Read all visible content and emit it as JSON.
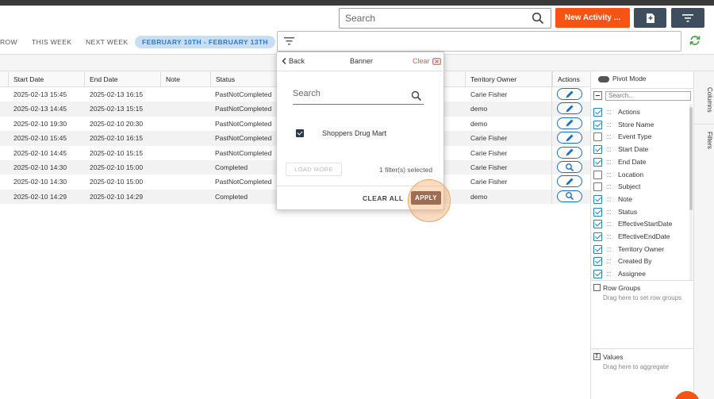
{
  "header": {
    "search_placeholder": "Search",
    "new_activity_label": "New Activity ...",
    "brand_color": "#f65314"
  },
  "periods": [
    {
      "label": "ROW",
      "active": false
    },
    {
      "label": "THIS WEEK",
      "active": false
    },
    {
      "label": "NEXT WEEK",
      "active": false
    },
    {
      "label": "FEBRUARY 10TH - FEBRUARY 13TH",
      "active": true
    }
  ],
  "grid": {
    "columns": [
      "Start Date",
      "End Date",
      "Note",
      "Status",
      "Territory Owner",
      "Actions"
    ],
    "rows": [
      {
        "start": "2025-02-13 15:45",
        "end": "2025-02-13 16:15",
        "status": "PastNotCompleted",
        "owner": "Carie Fisher",
        "action": "edit"
      },
      {
        "start": "2025-02-13 14:45",
        "end": "2025-02-13 15:15",
        "status": "PastNotCompleted",
        "owner": "demo",
        "action": "edit"
      },
      {
        "start": "2025-02-10 19:30",
        "end": "2025-02-10 20:30",
        "status": "PastNotCompleted",
        "owner": "demo",
        "action": "edit"
      },
      {
        "start": "2025-02-10 15:45",
        "end": "2025-02-10 16:15",
        "status": "PastNotCompleted",
        "owner": "Carie Fisher",
        "action": "edit"
      },
      {
        "start": "2025-02-10 14:45",
        "end": "2025-02-10 15:15",
        "status": "PastNotCompleted",
        "owner": "Carie Fisher",
        "action": "edit"
      },
      {
        "start": "2025-02-10 14:30",
        "end": "2025-02-10 15:00",
        "status": "Completed",
        "owner": "Carie Fisher",
        "action": "view"
      },
      {
        "start": "2025-02-10 14:30",
        "end": "2025-02-10 15:00",
        "status": "PastNotCompleted",
        "owner": "Carie Fisher",
        "action": "edit"
      },
      {
        "start": "2025-02-10 14:29",
        "end": "2025-02-10 14:29",
        "status": "Completed",
        "owner": "demo",
        "action": "view"
      }
    ]
  },
  "popup": {
    "back_label": "Back",
    "title": "Banner",
    "clear_label": "Clear",
    "search_placeholder": "Search",
    "item_label": "Shoppers Drug Mart",
    "load_more_label": "LOAD MORE",
    "filters_selected": "1 filter(s) selected",
    "clear_all_label": "CLEAR ALL",
    "apply_label": "APPLY"
  },
  "side_panel": {
    "pivot_label": "Pivot Mode",
    "column_search_placeholder": "Search...",
    "columns": [
      {
        "label": "Actions",
        "checked": true
      },
      {
        "label": "Store Name",
        "checked": true
      },
      {
        "label": "Event Type",
        "checked": false
      },
      {
        "label": "Start Date",
        "checked": true
      },
      {
        "label": "End Date",
        "checked": true
      },
      {
        "label": "Location",
        "checked": false
      },
      {
        "label": "Subject",
        "checked": false
      },
      {
        "label": "Note",
        "checked": true
      },
      {
        "label": "Status",
        "checked": true
      },
      {
        "label": "EffectiveStartDate",
        "checked": true
      },
      {
        "label": "EffectiveEndDate",
        "checked": true
      },
      {
        "label": "Territory Owner",
        "checked": true
      },
      {
        "label": "Created By",
        "checked": true
      },
      {
        "label": "Assignee",
        "checked": true
      }
    ],
    "row_groups_title": "Row Groups",
    "row_groups_hint": "Drag here to set row groups",
    "values_title": "Values",
    "values_hint": "Drag here to aggregate",
    "tab_columns": "Columns",
    "tab_filters": "Filters"
  }
}
